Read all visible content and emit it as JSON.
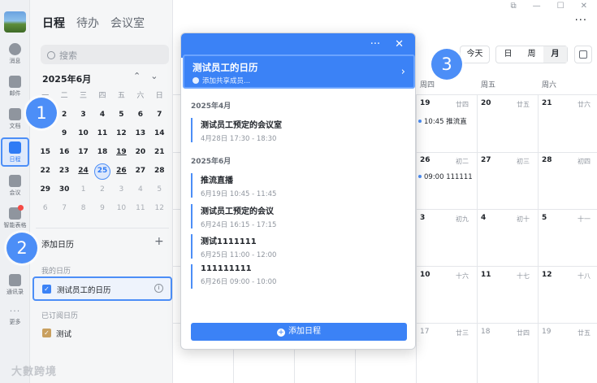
{
  "rail": [
    {
      "label": "消息",
      "icon": "chat-icon"
    },
    {
      "label": "邮件",
      "icon": "mail-icon"
    },
    {
      "label": "文档",
      "icon": "doc-icon"
    },
    {
      "label": "日程",
      "icon": "calendar-icon"
    },
    {
      "label": "会议",
      "icon": "meeting-icon"
    },
    {
      "label": "智能表格",
      "icon": "smart-table-icon"
    },
    {
      "label": "通讯录",
      "icon": "contacts-icon"
    },
    {
      "label": "更多",
      "icon": "more-icon"
    }
  ],
  "tabs": [
    "日程",
    "待办",
    "会议室"
  ],
  "search_placeholder": "搜索",
  "mini": {
    "title": "2025年6月",
    "weekdays": [
      "一",
      "二",
      "三",
      "四",
      "五",
      "六",
      "日"
    ],
    "days": [
      "",
      "2",
      "3",
      "4",
      "5",
      "6",
      "7",
      "",
      "9",
      "10",
      "11",
      "12",
      "13",
      "14",
      "15",
      "16",
      "17",
      "18",
      "19",
      "20",
      "21",
      "22",
      "23",
      "24",
      "25",
      "26",
      "27",
      "28",
      "29",
      "30",
      "1",
      "2",
      "3",
      "4",
      "5",
      "6",
      "7",
      "8",
      "9",
      "10",
      "11",
      "12"
    ]
  },
  "add_calendar": "添加日历",
  "my_calendars": "我的日历",
  "my_cal_name": "测试员工的日历",
  "subscribed": "已订阅日历",
  "sub_cal_name": "测试",
  "toolbar": {
    "today": "今天",
    "day": "日",
    "week": "周",
    "month": "月"
  },
  "week_headers": [
    "周四",
    "周五",
    "周六"
  ],
  "grid_cells": [
    {
      "d": "19",
      "l": "廿四"
    },
    {
      "d": "20",
      "l": "廿五"
    },
    {
      "d": "21",
      "l": "廿六"
    },
    {
      "d": "26",
      "l": "初二"
    },
    {
      "d": "27",
      "l": "初三"
    },
    {
      "d": "28",
      "l": "初四"
    },
    {
      "d": "3",
      "l": "初九"
    },
    {
      "d": "4",
      "l": "初十"
    },
    {
      "d": "5",
      "l": "十一"
    },
    {
      "d": "10",
      "l": "十六"
    },
    {
      "d": "11",
      "l": "十七"
    },
    {
      "d": "12",
      "l": "十八"
    },
    {
      "d": "17",
      "l": "廿三"
    },
    {
      "d": "18",
      "l": "廿四"
    },
    {
      "d": "19",
      "l": "廿五"
    }
  ],
  "grid_events": [
    "10:45 推流直",
    "09:00 111111"
  ],
  "popup": {
    "title": "测试员工的日历",
    "subtitle": "添加共享成员...",
    "months": [
      "2025年4月",
      "2025年6月"
    ],
    "events": [
      {
        "title": "测试员工预定的会议室",
        "when": "4月28日 17:30 - 18:30"
      },
      {
        "title": "推流直播",
        "when": "6月19日 10:45 - 11:45"
      },
      {
        "title": "测试员工预定的会议",
        "when": "6月24日 16:15 - 17:15"
      },
      {
        "title": "测试1111111",
        "when": "6月25日 11:00 - 12:00"
      },
      {
        "title": "111111111",
        "when": "6月26日 09:00 - 10:00"
      }
    ],
    "add_button": "添加日程"
  },
  "badges": [
    "1",
    "2",
    "3"
  ],
  "watermark": "大數跨境",
  "colors": {
    "accent": "#3b82f6",
    "highlight": "#4c8ef7",
    "sub_calendar": "#c9a05f"
  }
}
